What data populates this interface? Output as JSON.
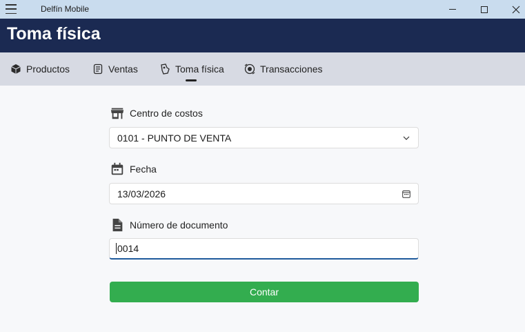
{
  "window": {
    "app_name": "Delfín Mobile"
  },
  "header": {
    "title": "Toma física"
  },
  "tabs": [
    {
      "label": "Productos",
      "icon": "box-icon"
    },
    {
      "label": "Ventas",
      "icon": "receipt-icon"
    },
    {
      "label": "Toma física",
      "icon": "hand-icon",
      "active": true
    },
    {
      "label": "Transacciones",
      "icon": "transactions-icon"
    }
  ],
  "form": {
    "centro": {
      "label": "Centro de costos",
      "value": "0101 - PUNTO DE VENTA"
    },
    "fecha": {
      "label": "Fecha",
      "value": "13/03/2026"
    },
    "documento": {
      "label": "Número de documento",
      "value": "0014"
    },
    "submit_label": "Contar"
  },
  "colors": {
    "titlebar": "#c9dcee",
    "header": "#1b2a52",
    "tabs_bg": "#d7dae3",
    "button": "#33ad4f",
    "focus_underline": "#1e5a9c"
  }
}
